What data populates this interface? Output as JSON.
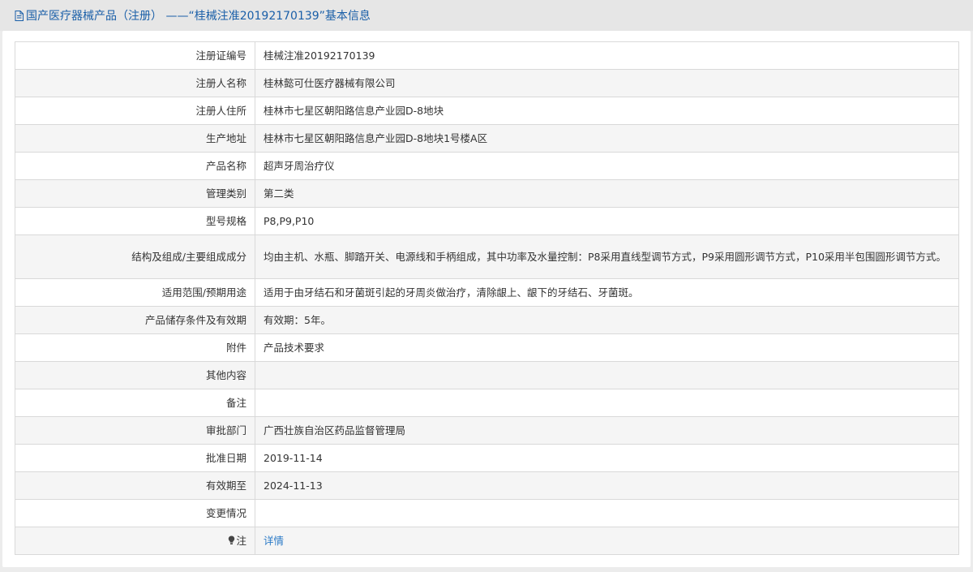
{
  "header": {
    "icon": "document-icon",
    "title": "国产医疗器械产品（注册） ——“桂械注准20192170139”基本信息"
  },
  "rows": [
    {
      "label": "注册证编号",
      "value": "桂械注准20192170139"
    },
    {
      "label": "注册人名称",
      "value": "桂林懿可仕医疗器械有限公司"
    },
    {
      "label": "注册人住所",
      "value": "桂林市七星区朝阳路信息产业园D-8地块"
    },
    {
      "label": "生产地址",
      "value": "桂林市七星区朝阳路信息产业园D-8地块1号楼A区"
    },
    {
      "label": "产品名称",
      "value": "超声牙周治疗仪"
    },
    {
      "label": "管理类别",
      "value": "第二类"
    },
    {
      "label": "型号规格",
      "value": "P8,P9,P10"
    },
    {
      "label": "结构及组成/主要组成成分",
      "value": "均由主机、水瓶、脚踏开关、电源线和手柄组成，其中功率及水量控制：P8采用直线型调节方式，P9采用圆形调节方式，P10采用半包围圆形调节方式。"
    },
    {
      "label": "适用范围/预期用途",
      "value": "适用于由牙结石和牙菌斑引起的牙周炎做治疗，清除龈上、龈下的牙结石、牙菌斑。"
    },
    {
      "label": "产品储存条件及有效期",
      "value": "有效期：5年。"
    },
    {
      "label": "附件",
      "value": "产品技术要求"
    },
    {
      "label": "其他内容",
      "value": ""
    },
    {
      "label": "备注",
      "value": ""
    },
    {
      "label": "审批部门",
      "value": "广西壮族自治区药品监督管理局"
    },
    {
      "label": "批准日期",
      "value": "2019-11-14"
    },
    {
      "label": "有效期至",
      "value": "2024-11-13"
    },
    {
      "label": "变更情况",
      "value": ""
    }
  ],
  "note": {
    "icon": "lightbulb-icon",
    "label": "注",
    "link_text": "详情"
  },
  "colors": {
    "header_text": "#1a5fa8",
    "link": "#2a7ac7",
    "border": "#d9d9d9",
    "row_alt": "#f5f5f5"
  }
}
